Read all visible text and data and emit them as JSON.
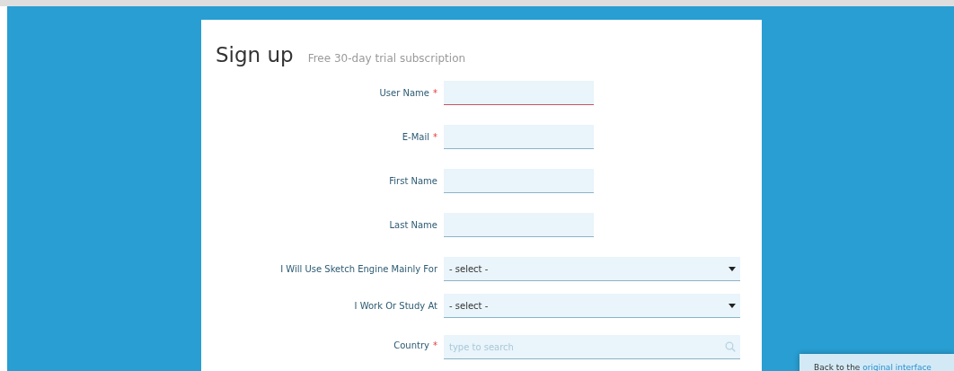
{
  "title": "Sign up",
  "subtitle": "Free 30-day trial subscription",
  "fields": [
    {
      "kind": "text",
      "label": "User Name",
      "required_mark": "*",
      "invalid": true
    },
    {
      "kind": "text",
      "label": "E-Mail",
      "required_mark": "*",
      "invalid": false
    },
    {
      "kind": "text",
      "label": "First Name",
      "invalid": false
    },
    {
      "kind": "text",
      "label": "Last Name",
      "invalid": false
    },
    {
      "kind": "select",
      "label": "I Will Use Sketch Engine Mainly For",
      "value": "- select -"
    },
    {
      "kind": "select",
      "label": "I Work Or Study At",
      "value": "- select -"
    },
    {
      "kind": "search",
      "label": "Country",
      "required_mark": "*",
      "placeholder": "type to search"
    }
  ],
  "notice": {
    "text": "Back to the ",
    "link": "original interface"
  }
}
